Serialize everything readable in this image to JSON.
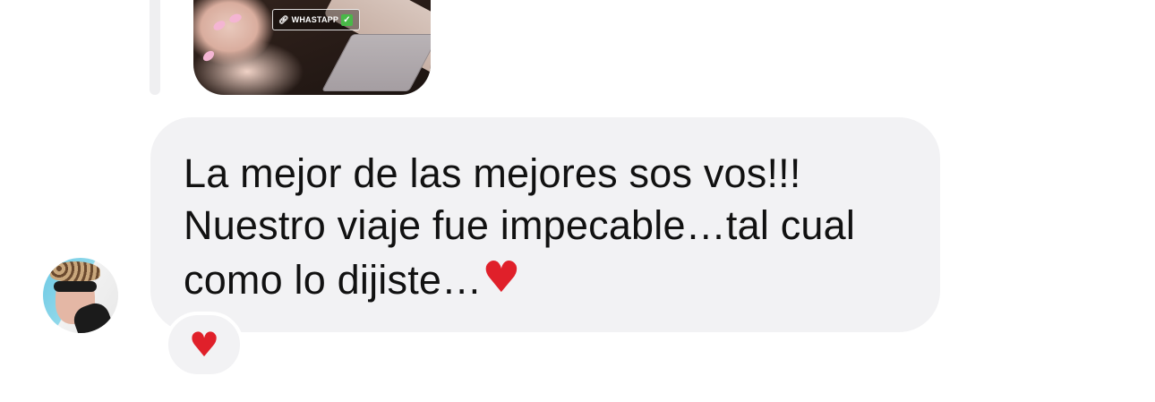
{
  "shared_media": {
    "link_label": "WHASTAPP",
    "link_icon": "link-icon",
    "check_icon": "check-icon",
    "check_glyph": "✓"
  },
  "message": {
    "lines": [
      "La mejor de las mejores sos vos!!!",
      "Nuestro viaje fue impecable…tal cual",
      "como lo dijiste…"
    ],
    "inline_emoji": "♥"
  },
  "reaction": {
    "emoji": "♥"
  },
  "colors": {
    "bubble": "#f2f2f4",
    "text": "#111111",
    "heart": "#e0202a",
    "check": "#49b848"
  }
}
